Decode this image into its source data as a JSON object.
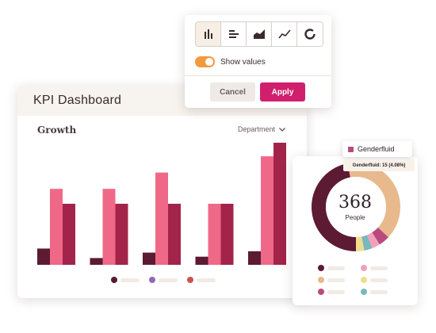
{
  "dashboard": {
    "title": "KPI Dashboard",
    "section_title": "Growth",
    "filter_label": "Department"
  },
  "popover": {
    "chart_types": [
      {
        "name": "bar",
        "icon": "bar-chart-icon",
        "active": true
      },
      {
        "name": "horizontal-bar",
        "icon": "horizontal-bar-icon",
        "active": false
      },
      {
        "name": "area",
        "icon": "area-chart-icon",
        "active": false
      },
      {
        "name": "line",
        "icon": "line-chart-icon",
        "active": false
      },
      {
        "name": "donut",
        "icon": "donut-chart-icon",
        "active": false
      }
    ],
    "show_values_label": "Show values",
    "show_values": true,
    "cancel_label": "Cancel",
    "apply_label": "Apply"
  },
  "donut": {
    "total": "368",
    "total_label": "People",
    "tooltip_label": "Genderfluid",
    "tooltip_detail": "Genderfluid: 15 (4.08%)"
  },
  "colors": {
    "maroon": "#5c1a33",
    "pink": "#f06888",
    "crimson": "#a3244a",
    "peach": "#e8b98c",
    "magenta": "#b84a7f",
    "light_pink": "#f2a1b8",
    "pale_yellow": "#f0dd8d",
    "teal": "#78b8be",
    "apply": "#d01f6c",
    "toggle": "#f39a3c"
  },
  "chart_data": [
    {
      "type": "bar",
      "categories": [
        "",
        "",
        "",
        "",
        ""
      ],
      "series": [
        {
          "color": "#5c1a33",
          "values": [
            12,
            5,
            9,
            6,
            10
          ]
        },
        {
          "color": "#f06888",
          "values": [
            56,
            56,
            68,
            45,
            80
          ]
        },
        {
          "color": "#a3244a",
          "values": [
            45,
            45,
            45,
            45,
            90
          ]
        }
      ],
      "ylim": [
        0,
        90
      ],
      "grid": false
    },
    {
      "type": "pie",
      "total": 368,
      "slices": [
        {
          "label": "",
          "value": 173,
          "color": "#5c1a33"
        },
        {
          "label": "",
          "value": 147,
          "color": "#e8b98c"
        },
        {
          "label": "Genderfluid",
          "value": 15,
          "color": "#b84a7f"
        },
        {
          "label": "",
          "value": 11,
          "color": "#f2a1b8"
        },
        {
          "label": "",
          "value": 11,
          "color": "#78b8be"
        },
        {
          "label": "",
          "value": 11,
          "color": "#f0dd8d"
        }
      ]
    }
  ]
}
